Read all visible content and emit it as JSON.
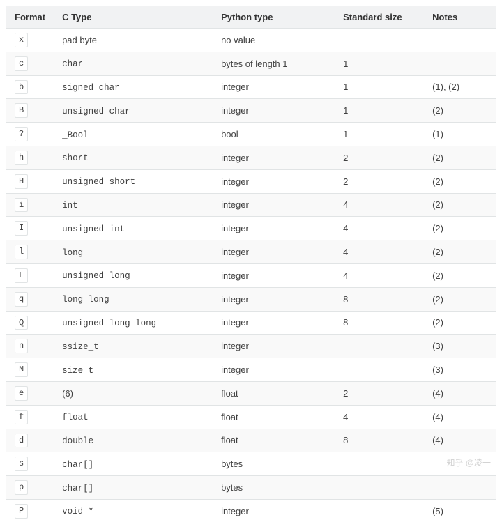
{
  "table": {
    "headers": {
      "format": "Format",
      "ctype": "C Type",
      "pytype": "Python type",
      "size": "Standard size",
      "notes": "Notes"
    },
    "rows": [
      {
        "format": "x",
        "ctype": "pad byte",
        "ctype_code": false,
        "pytype": "no value",
        "size": "",
        "notes": ""
      },
      {
        "format": "c",
        "ctype": "char",
        "ctype_code": true,
        "pytype": "bytes of length 1",
        "size": "1",
        "notes": ""
      },
      {
        "format": "b",
        "ctype": "signed char",
        "ctype_code": true,
        "pytype": "integer",
        "size": "1",
        "notes": "(1), (2)"
      },
      {
        "format": "B",
        "ctype": "unsigned char",
        "ctype_code": true,
        "pytype": "integer",
        "size": "1",
        "notes": "(2)"
      },
      {
        "format": "?",
        "ctype": "_Bool",
        "ctype_code": true,
        "pytype": "bool",
        "size": "1",
        "notes": "(1)"
      },
      {
        "format": "h",
        "ctype": "short",
        "ctype_code": true,
        "pytype": "integer",
        "size": "2",
        "notes": "(2)"
      },
      {
        "format": "H",
        "ctype": "unsigned short",
        "ctype_code": true,
        "pytype": "integer",
        "size": "2",
        "notes": "(2)"
      },
      {
        "format": "i",
        "ctype": "int",
        "ctype_code": true,
        "pytype": "integer",
        "size": "4",
        "notes": "(2)"
      },
      {
        "format": "I",
        "ctype": "unsigned int",
        "ctype_code": true,
        "pytype": "integer",
        "size": "4",
        "notes": "(2)"
      },
      {
        "format": "l",
        "ctype": "long",
        "ctype_code": true,
        "pytype": "integer",
        "size": "4",
        "notes": "(2)"
      },
      {
        "format": "L",
        "ctype": "unsigned long",
        "ctype_code": true,
        "pytype": "integer",
        "size": "4",
        "notes": "(2)"
      },
      {
        "format": "q",
        "ctype": "long long",
        "ctype_code": true,
        "pytype": "integer",
        "size": "8",
        "notes": "(2)"
      },
      {
        "format": "Q",
        "ctype": "unsigned long long",
        "ctype_code": true,
        "pytype": "integer",
        "size": "8",
        "notes": "(2)"
      },
      {
        "format": "n",
        "ctype": "ssize_t",
        "ctype_code": true,
        "pytype": "integer",
        "size": "",
        "notes": "(3)"
      },
      {
        "format": "N",
        "ctype": "size_t",
        "ctype_code": true,
        "pytype": "integer",
        "size": "",
        "notes": "(3)"
      },
      {
        "format": "e",
        "ctype": "(6)",
        "ctype_code": false,
        "pytype": "float",
        "size": "2",
        "notes": "(4)"
      },
      {
        "format": "f",
        "ctype": "float",
        "ctype_code": true,
        "pytype": "float",
        "size": "4",
        "notes": "(4)"
      },
      {
        "format": "d",
        "ctype": "double",
        "ctype_code": true,
        "pytype": "float",
        "size": "8",
        "notes": "(4)"
      },
      {
        "format": "s",
        "ctype": "char[]",
        "ctype_code": true,
        "pytype": "bytes",
        "size": "",
        "notes": ""
      },
      {
        "format": "p",
        "ctype": "char[]",
        "ctype_code": true,
        "pytype": "bytes",
        "size": "",
        "notes": ""
      },
      {
        "format": "P",
        "ctype": "void *",
        "ctype_code": true,
        "pytype": "integer",
        "size": "",
        "notes": "(5)"
      }
    ]
  },
  "watermark": "知乎 @凌一"
}
